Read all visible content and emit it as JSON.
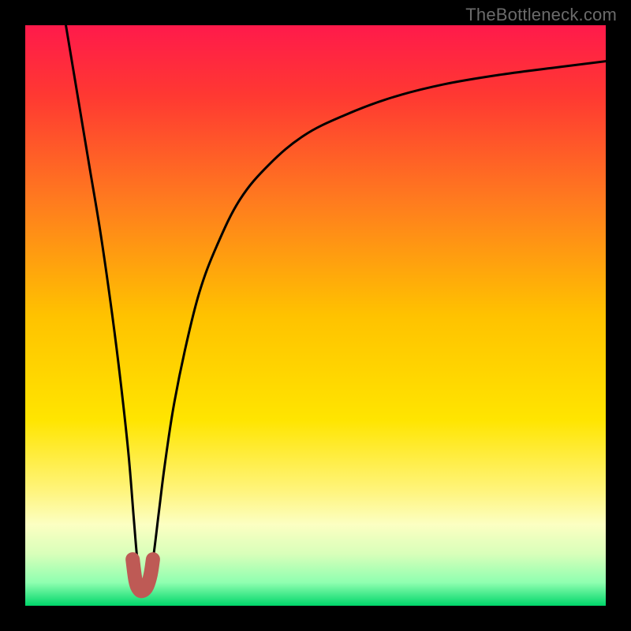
{
  "watermark": "TheBottleneck.com",
  "chart_data": {
    "type": "line",
    "title": "",
    "xlabel": "",
    "ylabel": "",
    "xlim": [
      0,
      100
    ],
    "ylim": [
      0,
      100
    ],
    "grid": false,
    "legend": false,
    "gradient_stops": [
      {
        "offset": 0.0,
        "color": "#ff1a4b"
      },
      {
        "offset": 0.12,
        "color": "#ff3832"
      },
      {
        "offset": 0.3,
        "color": "#ff7a1f"
      },
      {
        "offset": 0.5,
        "color": "#ffc200"
      },
      {
        "offset": 0.68,
        "color": "#ffe500"
      },
      {
        "offset": 0.8,
        "color": "#fff47a"
      },
      {
        "offset": 0.86,
        "color": "#fcffc2"
      },
      {
        "offset": 0.91,
        "color": "#d9ffba"
      },
      {
        "offset": 0.96,
        "color": "#8fffb0"
      },
      {
        "offset": 1.0,
        "color": "#00d66a"
      }
    ],
    "series": [
      {
        "name": "bottleneck-curve",
        "x": [
          7.0,
          9.0,
          11.0,
          13.0,
          15.0,
          16.5,
          17.8,
          18.7,
          19.3,
          20.0,
          21.0,
          22.0,
          23.0,
          24.0,
          25.5,
          27.5,
          30.0,
          33.0,
          37.0,
          42.0,
          48.0,
          55.0,
          63.0,
          72.0,
          82.0,
          92.0,
          100.0
        ],
        "y": [
          100.0,
          88.0,
          76.0,
          64.0,
          50.0,
          38.0,
          26.0,
          15.0,
          8.0,
          3.0,
          3.0,
          8.0,
          16.0,
          24.0,
          34.0,
          44.0,
          54.0,
          62.0,
          70.0,
          76.0,
          81.0,
          84.5,
          87.5,
          89.8,
          91.5,
          92.8,
          93.8
        ]
      }
    ],
    "highlight": {
      "name": "min-region",
      "color": "#be5a55",
      "x": [
        18.5,
        19.0,
        19.6,
        20.3,
        21.0,
        21.6,
        22.0
      ],
      "y": [
        8.0,
        4.3,
        2.8,
        2.6,
        3.4,
        5.4,
        8.0
      ]
    }
  }
}
